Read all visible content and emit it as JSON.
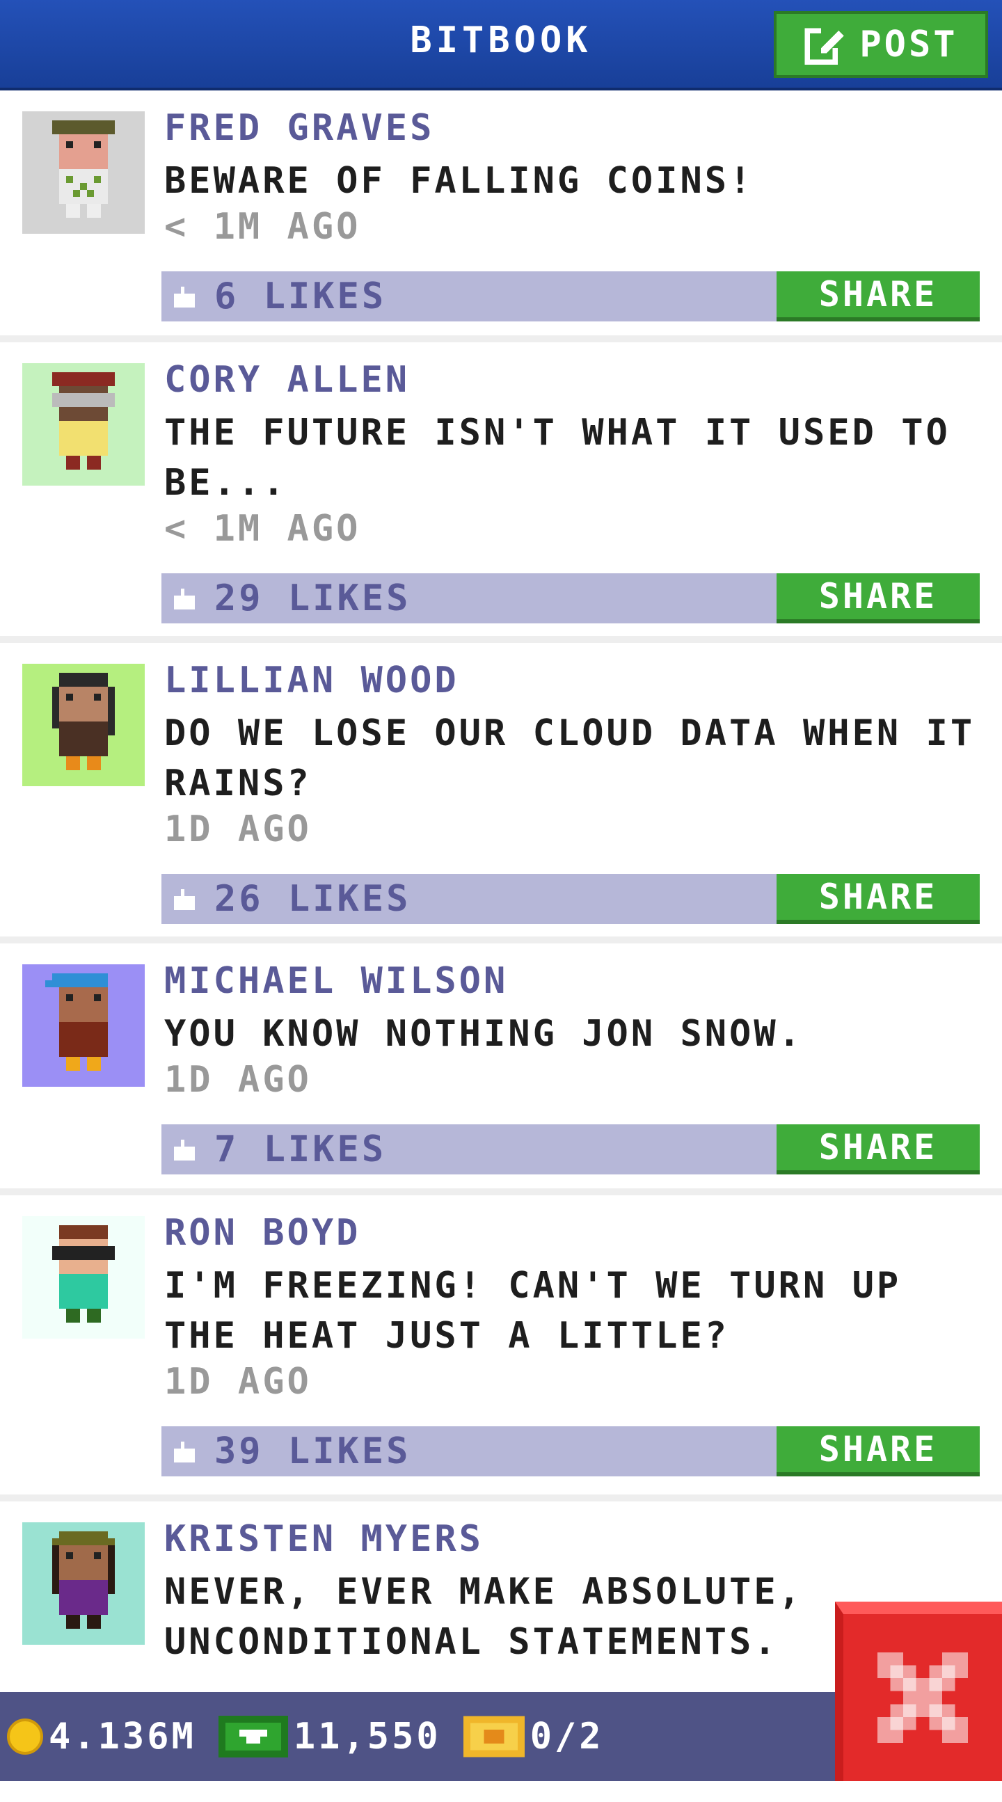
{
  "header": {
    "title": "BITBOOK",
    "post_label": "POST"
  },
  "feed": {
    "share_label": "SHARE",
    "posts": [
      {
        "author": "FRED GRAVES",
        "message": "BEWARE OF FALLING COINS!",
        "time": "< 1M AGO",
        "likes": "6 LIKES",
        "avatar_bg": "#d3d3d3"
      },
      {
        "author": "CORY ALLEN",
        "message": "THE FUTURE ISN'T WHAT IT USED TO BE...",
        "time": "< 1M AGO",
        "likes": "29 LIKES",
        "avatar_bg": "#c5f2be"
      },
      {
        "author": "LILLIAN WOOD",
        "message": "DO WE LOSE OUR CLOUD DATA WHEN IT RAINS?",
        "time": "1D AGO",
        "likes": "26 LIKES",
        "avatar_bg": "#b5ef7f"
      },
      {
        "author": "MICHAEL WILSON",
        "message": "YOU KNOW NOTHING JON SNOW.",
        "time": "1D AGO",
        "likes": "7 LIKES",
        "avatar_bg": "#9b8ff5"
      },
      {
        "author": "RON BOYD",
        "message": "I'M FREEZING! CAN'T WE TURN UP THE HEAT JUST A LITTLE?",
        "time": "1D AGO",
        "likes": "39 LIKES",
        "avatar_bg": "#f2fffa"
      },
      {
        "author": "KRISTEN MYERS",
        "message": "NEVER, EVER MAKE ABSOLUTE, UNCONDITIONAL STATEMENTS.",
        "avatar_bg": "#9ae2d2"
      }
    ]
  },
  "status": {
    "coins": "4.136M",
    "bux": "11,550",
    "tickets": "0/2"
  },
  "colors": {
    "header": "#183f98",
    "accent_green": "#3fac3a",
    "likes_bar": "#b6b7d8",
    "author_text": "#5a5a98",
    "close_red": "#e32a2a"
  },
  "icons": {
    "post": "compose-icon",
    "like": "thumbs-up-icon",
    "coin": "coin-icon",
    "bux": "bux-icon",
    "ticket": "ticket-icon",
    "close": "close-icon"
  }
}
